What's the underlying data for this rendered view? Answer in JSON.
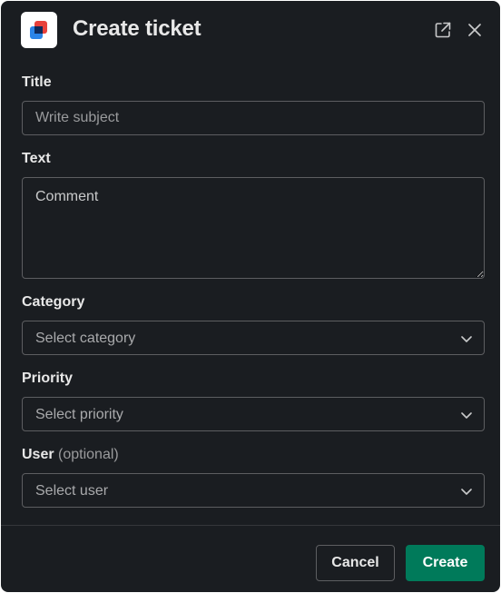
{
  "dialog": {
    "title": "Create ticket",
    "icons": {
      "app": "app-logo-icon",
      "open_external": "external-link-icon",
      "close": "close-icon"
    }
  },
  "form": {
    "title": {
      "label": "Title",
      "placeholder": "Write subject"
    },
    "text": {
      "label": "Text",
      "placeholder": "Comment"
    },
    "category": {
      "label": "Category",
      "value": "Select category"
    },
    "priority": {
      "label": "Priority",
      "value": "Select priority"
    },
    "user": {
      "label": "User",
      "optional": "(optional)",
      "value": "Select user"
    }
  },
  "footer": {
    "cancel_label": "Cancel",
    "create_label": "Create"
  },
  "colors": {
    "background": "#1a1d21",
    "border": "#5d5e61",
    "primary": "#007a5a",
    "logo_red": "#e8413b",
    "logo_blue": "#2a84e8"
  }
}
